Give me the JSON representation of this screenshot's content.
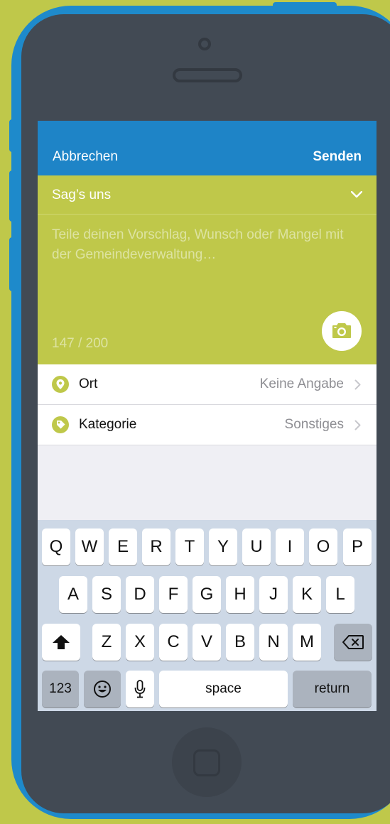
{
  "navbar": {
    "cancel_label": "Abbrechen",
    "send_label": "Senden"
  },
  "compose": {
    "title": "Sag’s uns",
    "placeholder": "Teile deinen Vorschlag, Wunsch oder Mangel mit der Gemeindeverwaltung…",
    "counter": "147 / 200"
  },
  "rows": [
    {
      "label": "Ort",
      "value": "Keine Angabe",
      "icon": "location-pin-icon"
    },
    {
      "label": "Kategorie",
      "value": "Sonstiges",
      "icon": "tag-icon"
    }
  ],
  "keyboard": {
    "row1": [
      "Q",
      "W",
      "E",
      "R",
      "T",
      "Y",
      "U",
      "I",
      "O",
      "P"
    ],
    "row2": [
      "A",
      "S",
      "D",
      "F",
      "G",
      "H",
      "J",
      "K",
      "L"
    ],
    "row3": [
      "Z",
      "X",
      "C",
      "V",
      "B",
      "N",
      "M"
    ],
    "numbers_label": "123",
    "space_label": "space",
    "return_label": "return"
  },
  "colors": {
    "accent_green": "#bfc84a",
    "nav_blue": "#1e84c7",
    "phone_blue": "#1e8acb",
    "phone_dark": "#424a54"
  }
}
